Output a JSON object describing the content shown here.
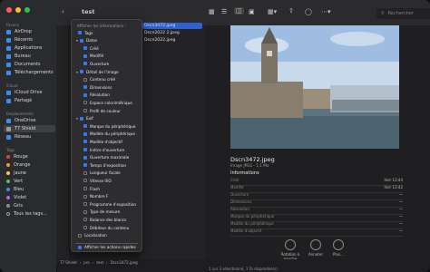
{
  "toolbar": {
    "title": "test",
    "search_placeholder": "Rechercher"
  },
  "sidebar": {
    "sections": [
      {
        "label": "Favoris",
        "items": [
          {
            "label": "AirDrop"
          },
          {
            "label": "Récents"
          },
          {
            "label": "Applications"
          },
          {
            "label": "Bureau"
          },
          {
            "label": "Documents"
          },
          {
            "label": "Téléchargements"
          }
        ]
      },
      {
        "label": "iCloud",
        "items": [
          {
            "label": "iCloud Drive"
          },
          {
            "label": "Partagé"
          }
        ]
      },
      {
        "label": "Emplacements",
        "items": [
          {
            "label": "OneDrive"
          },
          {
            "label": "T7 Shield"
          },
          {
            "label": "Réseau"
          }
        ]
      },
      {
        "label": "Tags",
        "items": [
          {
            "label": "Rouge",
            "color": "#e0443e"
          },
          {
            "label": "Orange",
            "color": "#f39a2b"
          },
          {
            "label": "Jaune",
            "color": "#f5d23b"
          },
          {
            "label": "Vert",
            "color": "#4fc35a"
          },
          {
            "label": "Bleu",
            "color": "#3d8df3"
          },
          {
            "label": "Violet",
            "color": "#b26ad8"
          },
          {
            "label": "Gris",
            "color": "#8e8e93"
          },
          {
            "label": "Tous les tags...",
            "color": ""
          }
        ]
      }
    ]
  },
  "files": [
    "Dscn3472.jpeg",
    "Dscn2022 2.jpeg",
    "Dscn2022.jpeg"
  ],
  "menu": {
    "header": "Afficher les informations :",
    "items": [
      {
        "label": "Tags",
        "type": "check",
        "checked": true
      },
      {
        "label": "Dates",
        "type": "group"
      },
      {
        "label": "Créé",
        "type": "sub",
        "checked": true
      },
      {
        "label": "Modifié",
        "type": "sub",
        "checked": true
      },
      {
        "label": "Ouverture",
        "type": "sub",
        "checked": true
      },
      {
        "label": "Détail de l'image",
        "type": "group"
      },
      {
        "label": "Contenu créé",
        "type": "sub",
        "checked": false
      },
      {
        "label": "Dimensions",
        "type": "sub",
        "checked": true
      },
      {
        "label": "Résolution",
        "type": "sub",
        "checked": true
      },
      {
        "label": "Espace colorimétrique",
        "type": "sub",
        "checked": false
      },
      {
        "label": "Profil de couleur",
        "type": "sub",
        "checked": false
      },
      {
        "label": "Exif",
        "type": "group"
      },
      {
        "label": "Marque du périphérique",
        "type": "sub",
        "checked": true
      },
      {
        "label": "Modèle du périphérique",
        "type": "sub",
        "checked": true
      },
      {
        "label": "Modèle d'objectif",
        "type": "sub",
        "checked": true
      },
      {
        "label": "Indice d'ouverture",
        "type": "sub",
        "checked": true
      },
      {
        "label": "Ouverture maximale",
        "type": "sub",
        "checked": true
      },
      {
        "label": "Temps d'exposition",
        "type": "sub",
        "checked": true
      },
      {
        "label": "Longueur focale",
        "type": "sub",
        "checked": false
      },
      {
        "label": "Vitesse ISO",
        "type": "sub",
        "checked": false
      },
      {
        "label": "Flash",
        "type": "sub",
        "checked": false
      },
      {
        "label": "Nombre F",
        "type": "sub",
        "checked": false
      },
      {
        "label": "Programme d'exposition",
        "type": "sub",
        "checked": false
      },
      {
        "label": "Type de mesure",
        "type": "sub",
        "checked": false
      },
      {
        "label": "Balance des blancs",
        "type": "sub",
        "checked": false
      },
      {
        "label": "Débiteur du contenu",
        "type": "sub",
        "checked": false
      },
      {
        "label": "Localisation",
        "type": "check",
        "checked": false
      },
      {
        "label": "Afficher les actions rapides",
        "type": "check",
        "checked": true
      }
    ]
  },
  "preview": {
    "filename": "Dscn3472.jpeg",
    "subtitle": "Image JPEG - 1,1 Mo",
    "info_title": "Informations",
    "rows": [
      {
        "label": "Créé",
        "value": "hier 13:44"
      },
      {
        "label": "Modifié",
        "value": "hier 13:42"
      },
      {
        "label": "Ouverture",
        "value": "—"
      },
      {
        "label": "Dimensions",
        "value": "—"
      },
      {
        "label": "Résolution",
        "value": "—"
      },
      {
        "label": "Marque du périphérique",
        "value": "—"
      },
      {
        "label": "Modèle du périphérique",
        "value": "—"
      },
      {
        "label": "Modèle d'objectif",
        "value": "—"
      }
    ],
    "actions": [
      {
        "label": "Rotation à gauche"
      },
      {
        "label": "Annoter"
      },
      {
        "label": "Plus..."
      }
    ]
  },
  "pathbar": [
    "T7 Shield",
    "pro",
    "test",
    "Dscn3472.jpeg"
  ],
  "status": "1 sur 3 sélectionné, 1 To disponible(s)"
}
